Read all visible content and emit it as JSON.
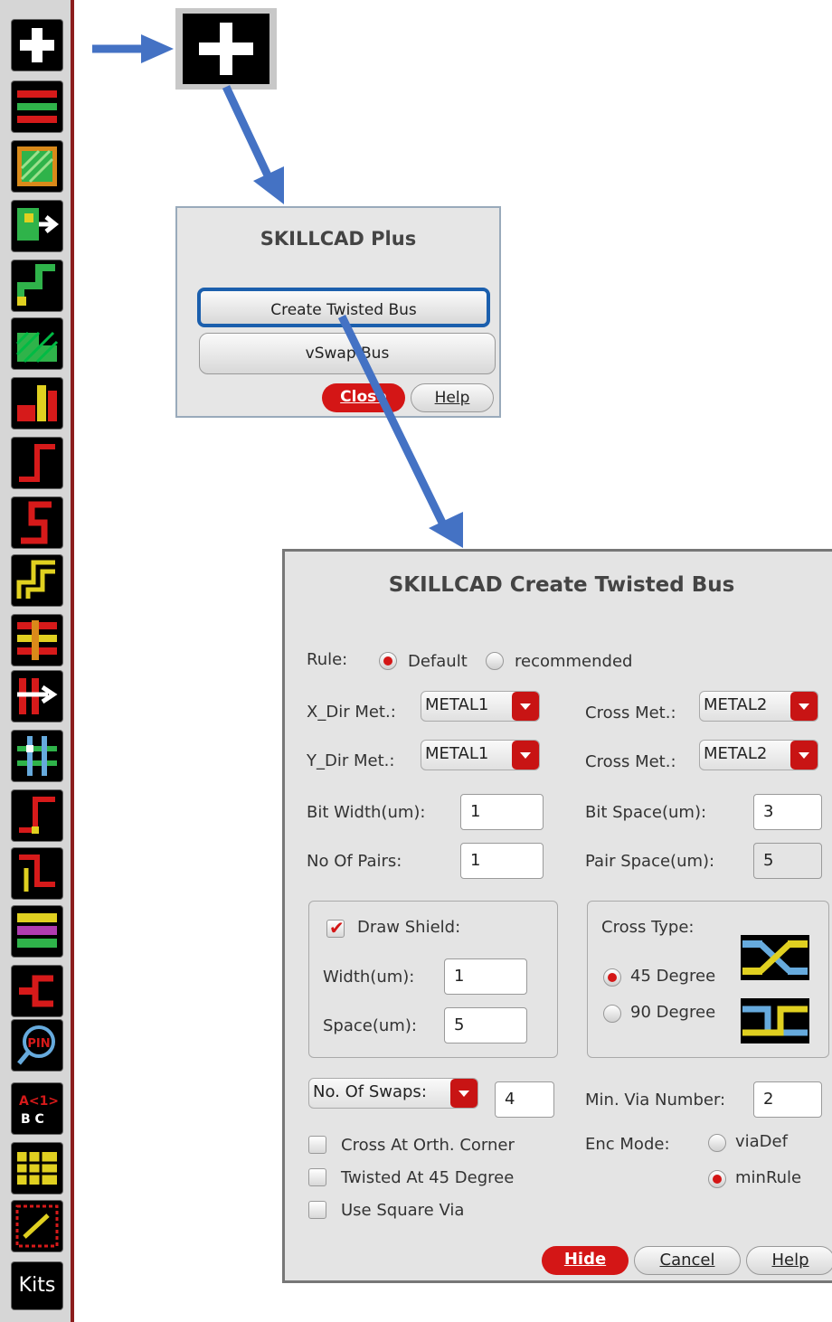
{
  "toolbar": {
    "items": [
      {
        "icon": "plus-icon"
      },
      {
        "icon": "metal-bar-icon"
      },
      {
        "icon": "fill-square-icon"
      },
      {
        "icon": "move-shape-icon"
      },
      {
        "icon": "step-path-icon"
      },
      {
        "icon": "hatched-stair-icon"
      },
      {
        "icon": "stack-bars-icon"
      },
      {
        "icon": "corner-path-icon"
      },
      {
        "icon": "zigzag-path-icon"
      },
      {
        "icon": "double-step-icon"
      },
      {
        "icon": "bus-lines-icon"
      },
      {
        "icon": "swap-arrow-icon"
      },
      {
        "icon": "grid-cross-icon"
      },
      {
        "icon": "corner-wire-icon"
      },
      {
        "icon": "offset-wire-icon"
      },
      {
        "icon": "shield-layers-icon"
      },
      {
        "icon": "bracket-icon"
      },
      {
        "icon": "pin-search-icon"
      },
      {
        "icon": "label-abc-icon"
      },
      {
        "icon": "pattern-grid-icon"
      },
      {
        "icon": "bit-array-icon"
      }
    ],
    "kits_label": "Kits"
  },
  "skillcad_plus": {
    "title": "SKILLCAD Plus",
    "create_twisted_bus": "Create Twisted Bus",
    "vswap_bus": "vSwap Bus",
    "close": "Close",
    "help": "Help"
  },
  "twisted_bus": {
    "title": "SKILLCAD Create Twisted Bus",
    "rule_label": "Rule:",
    "rule_default": "Default",
    "rule_recommended": "recommended",
    "rule_selected": "Default",
    "x_dir_met_label": "X_Dir Met.:",
    "x_dir_met_value": "METAL1",
    "x_cross_met_label": "Cross Met.:",
    "x_cross_met_value": "METAL2",
    "y_dir_met_label": "Y_Dir Met.:",
    "y_dir_met_value": "METAL1",
    "y_cross_met_label": "Cross Met.:",
    "y_cross_met_value": "METAL2",
    "bit_width_label": "Bit Width(um):",
    "bit_width_value": "1",
    "bit_space_label": "Bit Space(um):",
    "bit_space_value": "3",
    "no_of_pairs_label": "No Of Pairs:",
    "no_of_pairs_value": "1",
    "pair_space_label": "Pair Space(um):",
    "pair_space_value": "5",
    "draw_shield_label": "Draw Shield:",
    "draw_shield_checked": true,
    "shield_width_label": "Width(um):",
    "shield_width_value": "1",
    "shield_space_label": "Space(um):",
    "shield_space_value": "5",
    "cross_type_label": "Cross Type:",
    "cross_45": "45 Degree",
    "cross_90": "90 Degree",
    "cross_selected": "45 Degree",
    "swaps_select": "No. Of Swaps:",
    "swaps_value": "4",
    "min_via_label": "Min. Via Number:",
    "min_via_value": "2",
    "enc_mode_label": "Enc Mode:",
    "enc_viadef": "viaDef",
    "enc_minrule": "minRule",
    "enc_selected": "minRule",
    "cross_orth_corner": "Cross At Orth. Corner",
    "twisted_45": "Twisted At 45 Degree",
    "use_square_via": "Use Square Via",
    "hide": "Hide",
    "cancel": "Cancel",
    "help": "Help"
  },
  "colors": {
    "arrow": "#4472c4",
    "button_red": "#d41616",
    "highlight_border": "#1b5fad"
  }
}
